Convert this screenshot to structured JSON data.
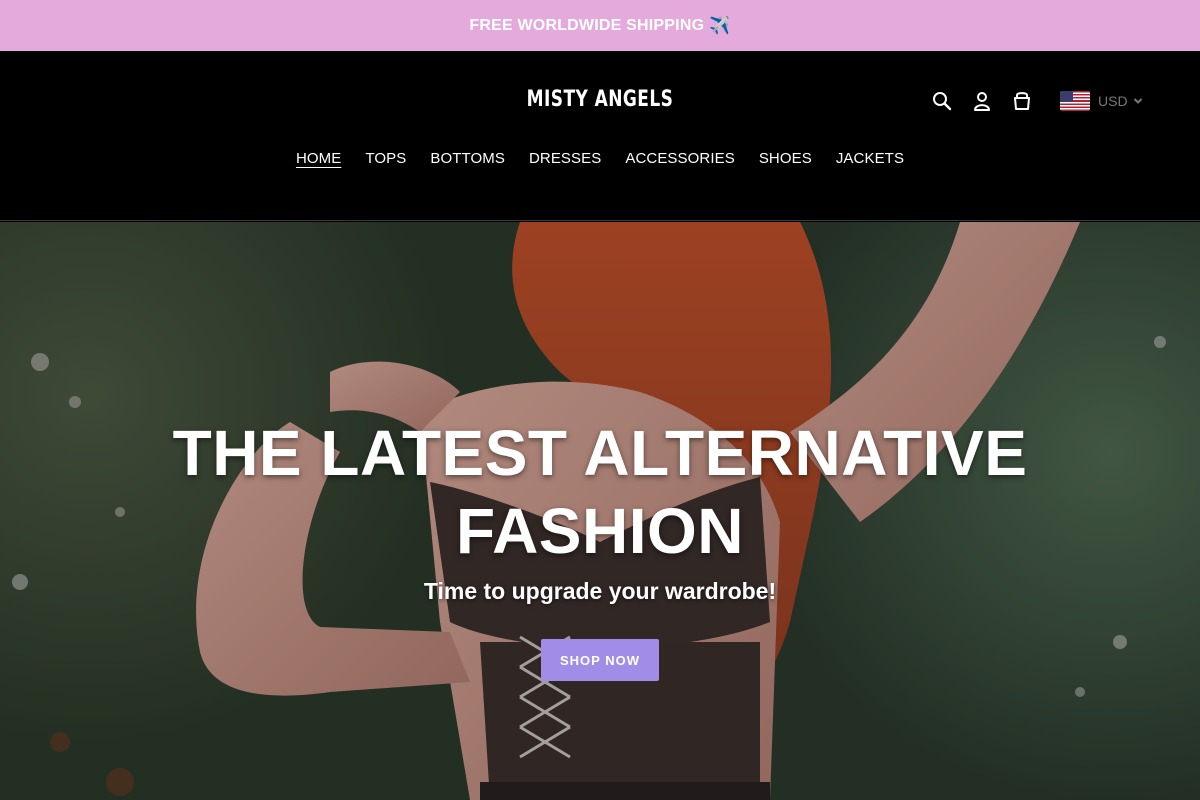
{
  "announcement": {
    "text": "FREE WORLDWIDE SHIPPING",
    "emoji": "✈️"
  },
  "header": {
    "logo": "MISTY ANGELS",
    "icons": [
      "search-icon",
      "account-icon",
      "cart-icon"
    ],
    "currency": {
      "code": "USD",
      "flag": "us-flag-icon"
    }
  },
  "nav": {
    "items": [
      {
        "label": "HOME",
        "active": true
      },
      {
        "label": "TOPS"
      },
      {
        "label": "BOTTOMS"
      },
      {
        "label": "DRESSES"
      },
      {
        "label": "ACCESSORIES"
      },
      {
        "label": "SHOES"
      },
      {
        "label": "JACKETS"
      }
    ]
  },
  "hero": {
    "title": "THE LATEST ALTERNATIVE FASHION",
    "subtitle": "Time to upgrade your wardrobe!",
    "button_label": "SHOP NOW"
  },
  "colors": {
    "announcement_bg": "#e3aadb",
    "header_bg": "#000000",
    "button_bg": "#a18de8"
  }
}
